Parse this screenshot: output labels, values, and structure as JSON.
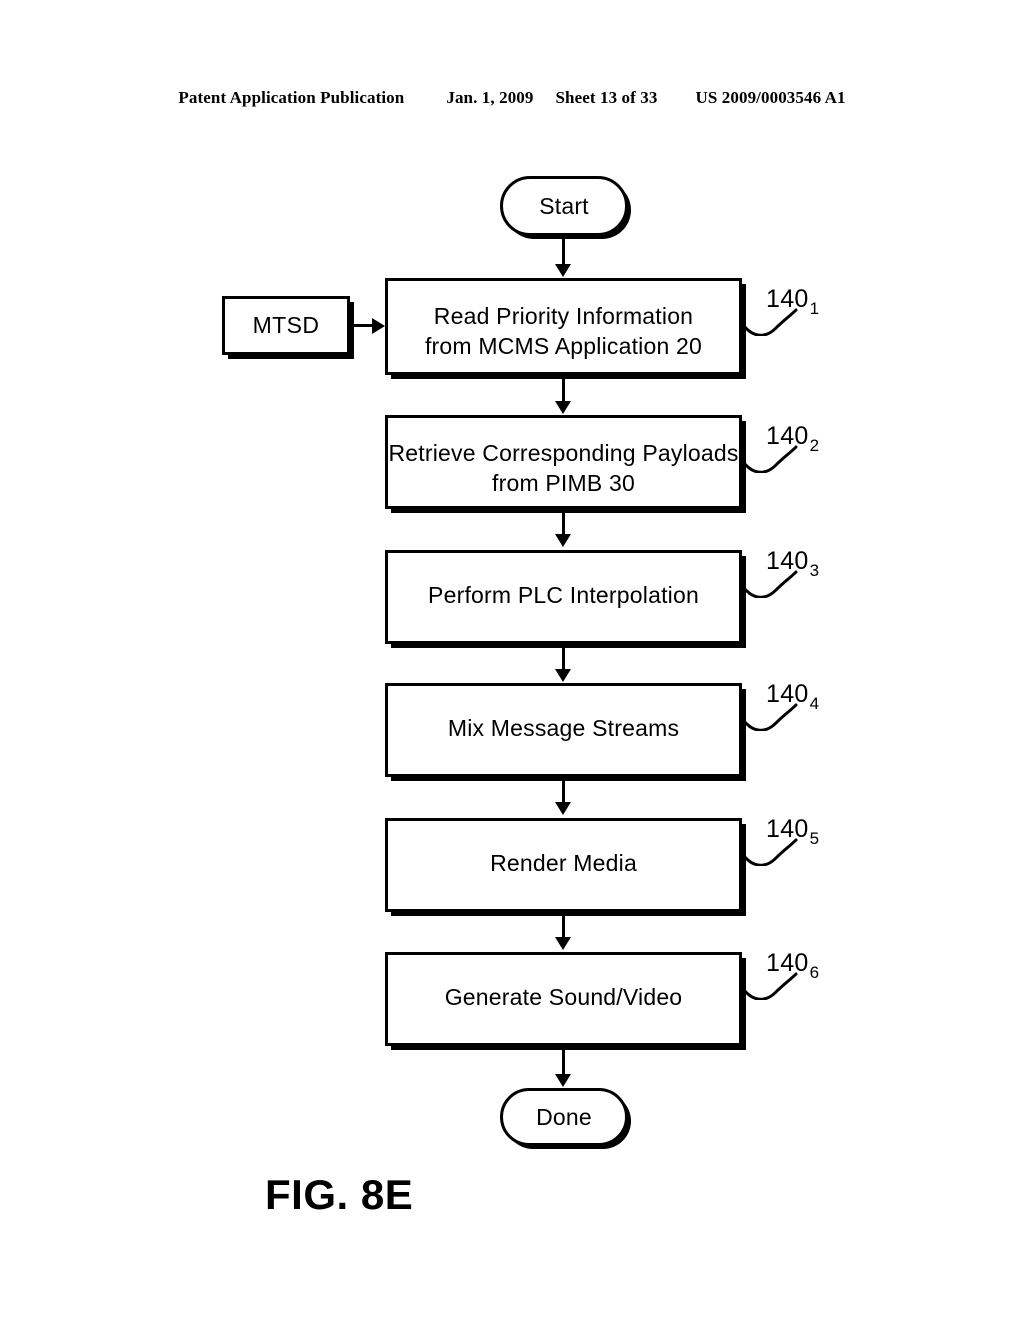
{
  "header": {
    "publication": "Patent Application Publication",
    "date": "Jan. 1, 2009",
    "sheet": "Sheet 13 of 33",
    "patent_number": "US 2009/0003546 A1"
  },
  "figure": {
    "caption": "FIG. 8E"
  },
  "flowchart": {
    "start_label": "Start",
    "end_label": "Done",
    "source_label": "MTSD",
    "steps": [
      {
        "text": "Read Priority Information\nfrom MCMS Application 20",
        "ref_base": "140",
        "ref_sub": "1"
      },
      {
        "text": "Retrieve Corresponding Payloads\nfrom PIMB 30",
        "ref_base": "140",
        "ref_sub": "2"
      },
      {
        "text": "Perform PLC Interpolation",
        "ref_base": "140",
        "ref_sub": "3"
      },
      {
        "text": "Mix Message Streams",
        "ref_base": "140",
        "ref_sub": "4"
      },
      {
        "text": "Render Media",
        "ref_base": "140",
        "ref_sub": "5"
      },
      {
        "text": "Generate Sound/Video",
        "ref_base": "140",
        "ref_sub": "6"
      }
    ]
  }
}
